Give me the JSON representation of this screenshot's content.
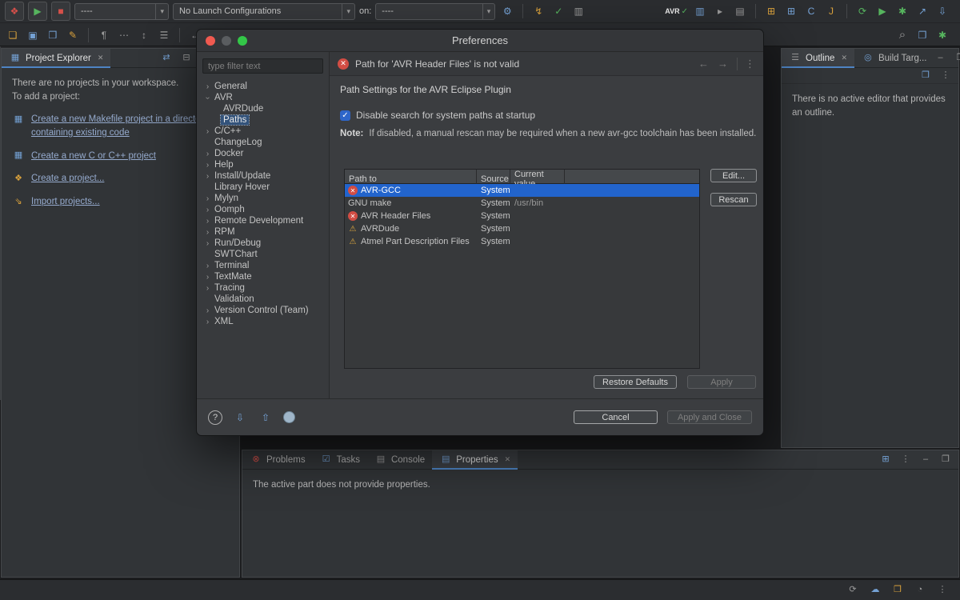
{
  "window": {
    "title": "Preferences"
  },
  "toolbar": {
    "avr_label": "AVR",
    "launch_bar": {
      "profiles": "----",
      "configurations": "No Launch Configurations",
      "on_label": "on:",
      "target": "----"
    }
  },
  "project_explorer": {
    "tab": "Project Explorer",
    "line1": "There are no projects in your workspace.",
    "line2": "To add a project:",
    "links": [
      "Create a new Makefile project in a directory containing existing code",
      "Create a new C or C++ project",
      "Create a project...",
      "Import projects..."
    ]
  },
  "preferences": {
    "title": "Preferences",
    "filter_placeholder": "type filter text",
    "tree": [
      "General",
      "AVR",
      "AVRDude",
      "Paths",
      "C/C++",
      "ChangeLog",
      "Docker",
      "Help",
      "Install/Update",
      "Library Hover",
      "Mylyn",
      "Oomph",
      "Remote Development",
      "RPM",
      "Run/Debug",
      "SWTChart",
      "Terminal",
      "TextMate",
      "Tracing",
      "Validation",
      "Version Control (Team)",
      "XML"
    ],
    "banner": "Path for 'AVR Header Files' is not valid",
    "page_title": "Path Settings for the AVR Eclipse Plugin",
    "checkbox_label": "Disable search for system paths at startup",
    "note_label": "Note:",
    "note_text": "If disabled, a manual rescan may be required when a new avr-gcc toolchain has been installed.",
    "table": {
      "columns": [
        "Path to",
        "Source",
        "Current value"
      ],
      "rows": [
        {
          "name": "AVR-GCC",
          "icon": "error",
          "source": "System",
          "value": "",
          "selected": true
        },
        {
          "name": "GNU make",
          "icon": "none",
          "source": "System",
          "value": "/usr/bin",
          "selected": false
        },
        {
          "name": "AVR Header Files",
          "icon": "error",
          "source": "System",
          "value": "",
          "selected": false
        },
        {
          "name": "AVRDude",
          "icon": "warning",
          "source": "System",
          "value": "",
          "selected": false
        },
        {
          "name": "Atmel Part Description Files",
          "icon": "warning",
          "source": "System",
          "value": "",
          "selected": false
        }
      ]
    },
    "buttons": {
      "edit": "Edit...",
      "rescan": "Rescan",
      "restore_defaults": "Restore Defaults",
      "apply": "Apply",
      "cancel": "Cancel",
      "apply_and_close": "Apply and Close"
    }
  },
  "outline": {
    "tab": "Outline",
    "tab_build": "Build Targ...",
    "message": "There is no active editor that provides an outline."
  },
  "bottom_panel": {
    "tabs": [
      "Problems",
      "Tasks",
      "Console",
      "Properties"
    ],
    "message": "The active part does not provide properties."
  },
  "colors": {
    "selection": "#2264cc",
    "error": "#d24d44",
    "warning": "#e0a93e",
    "link": "#95aacd",
    "tab_accent": "#4e84c4",
    "checkbox": "#2e66c9"
  },
  "icons": {
    "close": "✕",
    "kebab": "⋮",
    "min": "–",
    "max": "❐",
    "chev": "›",
    "drop": "▾",
    "back": "←",
    "fwd": "→",
    "search": "⌕",
    "gear": "⚙",
    "play": "▶",
    "stop": "■",
    "check": "✓",
    "warn": "⚠",
    "help": "?",
    "pilcrow": "¶",
    "dots": "⋯",
    "updown": "↕",
    "list": "☰",
    "folder": "❏",
    "save": "▣",
    "save_all": "❒",
    "wizard": "❖",
    "flash": "↯",
    "monitor": "▥",
    "console": "▤",
    "newbox": "⊞",
    "c": "C",
    "j": "J",
    "refresh": "⟳",
    "ext": "↗",
    "down": "⇩",
    "up": "⇧",
    "funnel": "▽",
    "collapse": "⊟",
    "link": "⇄",
    "spark": "✱",
    "tasks": "☑",
    "problems": "⊗",
    "target": "◎",
    "pencil": "✎",
    "cloud": "☁",
    "pie": "◔",
    "dot": "●",
    "term": "▸",
    "grid": "▦",
    "import_arrow": "⇘"
  }
}
